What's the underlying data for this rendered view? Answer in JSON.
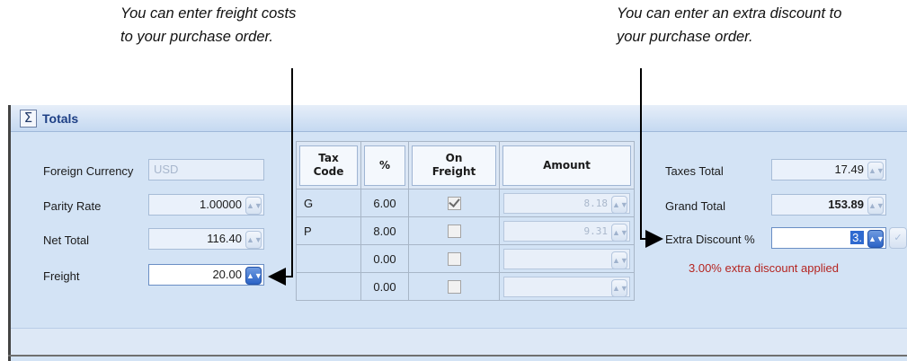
{
  "callouts": {
    "left": "You can enter freight costs\nto your purchase order.",
    "right": "You can enter an extra discount to\nyour purchase order."
  },
  "panel": {
    "title": "Totals",
    "icon": "sigma-icon"
  },
  "left": {
    "foreign_currency": {
      "label": "Foreign Currency",
      "value": "USD"
    },
    "parity_rate": {
      "label": "Parity Rate",
      "value": "1.00000"
    },
    "net_total": {
      "label": "Net Total",
      "value": "116.40"
    },
    "freight": {
      "label": "Freight",
      "value": "20.00"
    }
  },
  "tax_table": {
    "headers": {
      "code": "Tax\nCode",
      "percent": "%",
      "on_freight": "On\nFreight",
      "amount": "Amount"
    },
    "rows": [
      {
        "code": "G",
        "percent": "6.00",
        "on_freight": true,
        "amount": "8.18"
      },
      {
        "code": "P",
        "percent": "8.00",
        "on_freight": false,
        "amount": "9.31"
      },
      {
        "code": "",
        "percent": "0.00",
        "on_freight": false,
        "amount": ""
      },
      {
        "code": "",
        "percent": "0.00",
        "on_freight": false,
        "amount": ""
      }
    ]
  },
  "right": {
    "taxes_total": {
      "label": "Taxes Total",
      "value": "17.49"
    },
    "grand_total": {
      "label": "Grand Total",
      "value": "153.89"
    },
    "extra_discount": {
      "label": "Extra Discount %",
      "value": "3."
    },
    "note": "3.00% extra discount applied"
  },
  "colors": {
    "accent": "#2b63c6",
    "note": "#b52420",
    "panel_bg": "#d3e3f5"
  }
}
